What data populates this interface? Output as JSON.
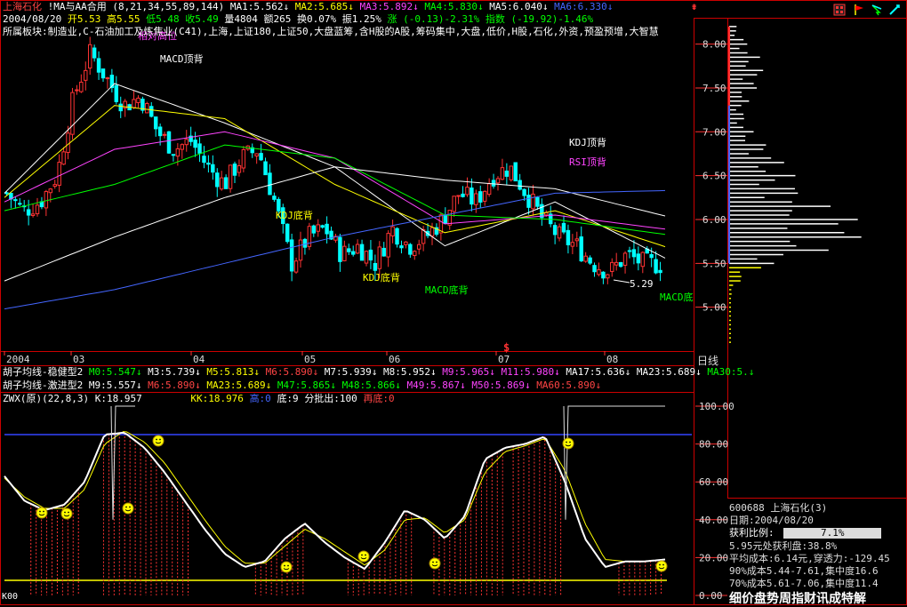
{
  "header": {
    "stock_name": "上海石化",
    "indicator_title": "!MA与AA合用",
    "indicator_params": "(8,21,34,55,89,144)",
    "ma_values": [
      {
        "label": "MA1:5.562",
        "color": "#ffffff"
      },
      {
        "label": "MA2:5.685",
        "color": "#ffff00"
      },
      {
        "label": "MA3:5.892",
        "color": "#ff44ff"
      },
      {
        "label": "MA4:5.830",
        "color": "#00ff00"
      },
      {
        "label": "MA5:6.040",
        "color": "#ffffff"
      },
      {
        "label": "MA6:6.330",
        "color": "#4466ff"
      }
    ],
    "date": "2004/08/20",
    "open": "开5.53",
    "high": "高5.55",
    "low": "低5.48",
    "close": "收5.49",
    "volume": "量4804",
    "amount": "额265",
    "turnover": "换0.07%",
    "amplitude": "振1.25%",
    "change": "涨 (-0.13)-2.31%",
    "index": "指数 (-19.92)-1.46%"
  },
  "sector_line": "所属板块:制造业,C-石油加工及炼焦业(C41),上海,上证180,上证50,大盘蓝筹,含H股的A股,筹码集中,大盘,低价,H股,石化,外资,预盈预增,大智慧",
  "annotations": [
    {
      "text": "MACD顶背",
      "color": "#ffffff"
    },
    {
      "text": "KDJ底背",
      "color": "#ffff00"
    },
    {
      "text": "KDJ底背",
      "color": "#ffff00"
    },
    {
      "text": "MACD底背",
      "color": "#00ff00"
    },
    {
      "text": "KDJ顶背",
      "color": "#ffffff"
    },
    {
      "text": "RSI顶背",
      "color": "#ff44ff"
    },
    {
      "text": "MACD底",
      "color": "#00ff00"
    },
    {
      "text": "5.29",
      "color": "#ffffff"
    },
    {
      "text": "相对高位",
      "color": "#ff44ff"
    }
  ],
  "price_axis": [
    "8.00",
    "7.50",
    "7.00",
    "6.50",
    "6.00",
    "5.50",
    "5.00"
  ],
  "time_axis": [
    "2004",
    "03",
    "04",
    "05",
    "06",
    "07",
    "08"
  ],
  "time_axis_suffix": "日线",
  "row1": {
    "title": "胡子均线-稳健型2",
    "items": [
      {
        "label": "M0:5.547",
        "color": "#00ff00"
      },
      {
        "label": "M3:5.739",
        "color": "#ffffff"
      },
      {
        "label": "M5:5.813",
        "color": "#ffff00"
      },
      {
        "label": "M6:5.890",
        "color": "#ff4444"
      },
      {
        "label": "M7:5.939",
        "color": "#ffffff"
      },
      {
        "label": "M8:5.952",
        "color": "#ffffff"
      },
      {
        "label": "M9:5.965",
        "color": "#ff44ff"
      },
      {
        "label": "M11:5.980",
        "color": "#ff44ff"
      },
      {
        "label": "MA17:5.636",
        "color": "#ffffff"
      },
      {
        "label": "MA23:5.689",
        "color": "#ffffff"
      },
      {
        "label": "MA30:5.",
        "color": "#00ff00"
      }
    ]
  },
  "row2": {
    "title": "胡子均线-激进型2",
    "items": [
      {
        "label": "M9:5.557",
        "color": "#ffffff"
      },
      {
        "label": "M6:5.890",
        "color": "#ff4444"
      },
      {
        "label": "MA23:5.689",
        "color": "#ffff00"
      },
      {
        "label": "M47:5.865",
        "color": "#00ff00"
      },
      {
        "label": "M48:5.866",
        "color": "#00ff00"
      },
      {
        "label": "M49:5.867",
        "color": "#ff44ff"
      },
      {
        "label": "M50:5.869",
        "color": "#ff44ff"
      },
      {
        "label": "MA60:5.890",
        "color": "#ff4444"
      }
    ]
  },
  "zwx": {
    "title": "ZWX(原)(22,8,3)",
    "k_label": "K:18.957",
    "kk_label": "KK:18.976",
    "high_label": "高:0",
    "low_label": "底:9",
    "points_label": "分批出:100",
    "top_label": "再底:0"
  },
  "osc_axis": [
    "100.00",
    "80.00",
    "60.00",
    "40.00",
    "20.00",
    "0.00"
  ],
  "bottom_left_label": "K00",
  "panel": {
    "code_line": "600688  上海石化(3)",
    "date_line": "日期:2004/08/20",
    "profit_label": "获利比例:",
    "profit_value": "7.1%",
    "line1": "5.95元处获利盘:38.8%",
    "line2": "平均成本:6.14元,穿透力:-129.45",
    "line3": "90%成本5.44-7.61,集中度16.6",
    "line4": "70%成本5.61-7.06,集中度11.4",
    "footer": "细价盘势周指财讯成特解"
  },
  "chart_data": [
    {
      "type": "candlestick",
      "title": "上海石化",
      "ylabel": "",
      "ylim": [
        4.5,
        8.3
      ],
      "x": [
        "2004",
        "03",
        "04",
        "05",
        "06",
        "07",
        "08"
      ],
      "series": [
        {
          "name": "MA1",
          "color": "#ffffff",
          "values": [
            6.3,
            7.55,
            7.1,
            6.6,
            5.7,
            6.2,
            5.56
          ]
        },
        {
          "name": "MA2",
          "color": "#ffff00",
          "values": [
            6.25,
            7.3,
            7.15,
            6.4,
            5.85,
            6.1,
            5.69
          ]
        },
        {
          "name": "MA3",
          "color": "#ff44ff",
          "values": [
            6.2,
            6.8,
            7.0,
            6.7,
            5.95,
            6.05,
            5.89
          ]
        },
        {
          "name": "MA4",
          "color": "#00ff00",
          "values": [
            6.1,
            6.4,
            6.85,
            6.7,
            6.05,
            6.0,
            5.83
          ]
        },
        {
          "name": "MA5",
          "color": "#ffffff",
          "values": [
            5.3,
            5.8,
            6.25,
            6.6,
            6.45,
            6.35,
            6.04
          ]
        },
        {
          "name": "MA6",
          "color": "#4466ff",
          "values": [
            4.98,
            5.2,
            5.5,
            5.8,
            6.05,
            6.3,
            6.33
          ]
        }
      ],
      "close_prices": [
        6.3,
        6.1,
        6.2,
        6.5,
        7.4,
        7.9,
        7.6,
        7.3,
        7.4,
        7.0,
        6.8,
        6.9,
        6.6,
        6.4,
        6.7,
        6.8,
        6.2,
        5.5,
        5.8,
        5.9,
        5.6,
        5.7,
        5.5,
        5.9,
        5.7,
        5.8,
        6.0,
        6.3,
        6.2,
        6.5,
        6.6,
        6.3,
        6.0,
        5.8,
        5.7,
        5.5,
        5.4,
        5.6,
        5.5,
        5.49
      ]
    },
    {
      "type": "line",
      "title": "ZWX(原)(22,8,3)",
      "ylim": [
        0,
        100
      ],
      "series": [
        {
          "name": "K",
          "color": "#ffffff",
          "values": [
            63,
            50,
            45,
            48,
            60,
            85,
            86,
            78,
            65,
            50,
            35,
            22,
            15,
            18,
            30,
            38,
            28,
            20,
            14,
            28,
            45,
            40,
            30,
            42,
            72,
            78,
            80,
            84,
            60,
            30,
            15,
            18,
            18,
            19
          ]
        },
        {
          "name": "KK",
          "color": "#ffff00",
          "values": [
            62,
            52,
            46,
            46,
            56,
            80,
            87,
            81,
            70,
            55,
            40,
            26,
            17,
            17,
            26,
            35,
            30,
            23,
            16,
            24,
            40,
            41,
            33,
            40,
            65,
            76,
            79,
            83,
            66,
            38,
            19,
            18,
            18,
            19
          ]
        }
      ]
    }
  ]
}
